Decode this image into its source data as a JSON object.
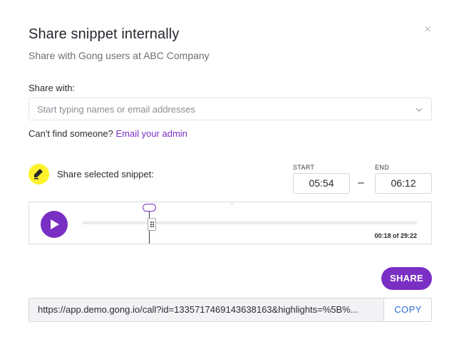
{
  "modal": {
    "close_glyph": "×",
    "title": "Share snippet internally",
    "subtitle": "Share with Gong users at ABC Company"
  },
  "share_with": {
    "label": "Share with:",
    "placeholder": "Start typing names or email addresses",
    "chevron_icon": "chevron-down-icon"
  },
  "cant_find": {
    "text": "Can't find someone?",
    "link_label": "Email your admin"
  },
  "snippet": {
    "icon": "highlighter-icon",
    "icon_color": "#fff22d",
    "label": "Share selected snippet:",
    "start_label": "START",
    "start_value": "05:54",
    "end_label": "END",
    "end_value": "06:12",
    "separator": "–"
  },
  "player": {
    "play_icon": "play-icon",
    "time_readout": "00:18 of 29:22",
    "accent_color": "#7a2fc4"
  },
  "actions": {
    "share_label": "SHARE",
    "link_url": "https://app.demo.gong.io/call?id=1335717469143638163&highlights=%5B%...",
    "copy_label": "COPY"
  }
}
